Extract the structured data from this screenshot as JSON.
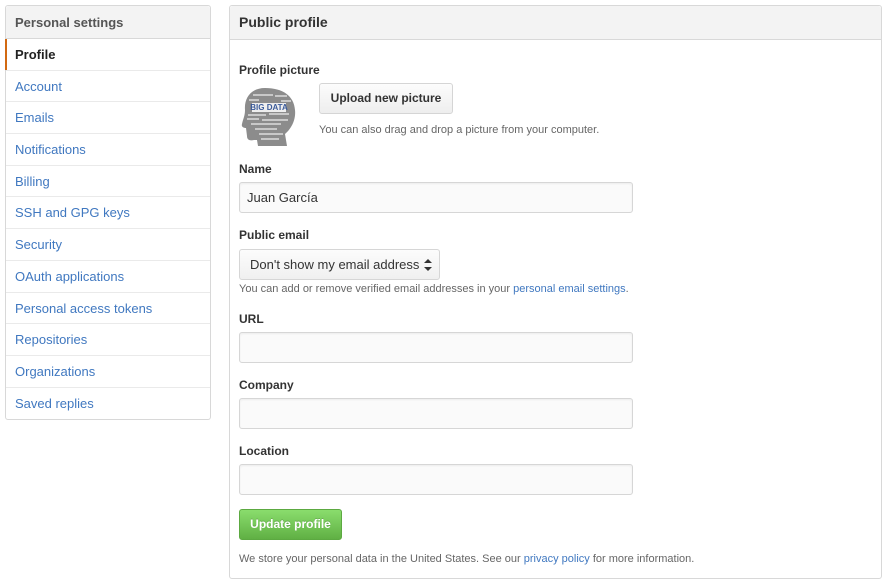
{
  "sidebar": {
    "title": "Personal settings",
    "items": [
      {
        "label": "Profile"
      },
      {
        "label": "Account"
      },
      {
        "label": "Emails"
      },
      {
        "label": "Notifications"
      },
      {
        "label": "Billing"
      },
      {
        "label": "SSH and GPG keys"
      },
      {
        "label": "Security"
      },
      {
        "label": "OAuth applications"
      },
      {
        "label": "Personal access tokens"
      },
      {
        "label": "Repositories"
      },
      {
        "label": "Organizations"
      },
      {
        "label": "Saved replies"
      }
    ],
    "selected": "Profile"
  },
  "main": {
    "title": "Public profile",
    "profile_picture": {
      "label": "Profile picture",
      "upload_button": "Upload new picture",
      "hint": "You can also drag and drop a picture from your computer.",
      "avatar_text": "BIG DATA"
    },
    "name": {
      "label": "Name",
      "value": "Juan García"
    },
    "public_email": {
      "label": "Public email",
      "selected": "Don't show my email address",
      "hint_prefix": "You can add or remove verified email addresses in your ",
      "hint_link": "personal email settings",
      "hint_suffix": "."
    },
    "url": {
      "label": "URL",
      "value": ""
    },
    "company": {
      "label": "Company",
      "value": ""
    },
    "location": {
      "label": "Location",
      "value": ""
    },
    "update_button": "Update profile",
    "note_prefix": "We store your personal data in the United States. See our ",
    "note_link": "privacy policy",
    "note_suffix": " for more information."
  },
  "colors": {
    "link": "#4078c0",
    "selected_accent": "#d26911",
    "primary_button": "#60b044"
  }
}
